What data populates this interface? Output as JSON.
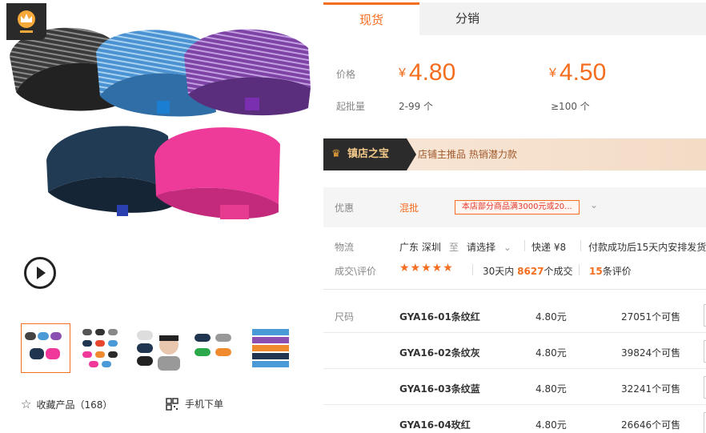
{
  "gallery": {
    "thumbnails_count": 5,
    "collect_label": "收藏产品（168）",
    "mobile_order_label": "手机下单"
  },
  "tabs": [
    {
      "label": "现货",
      "active": true
    },
    {
      "label": "分销",
      "active": false
    }
  ],
  "pricing": {
    "price_label": "价格",
    "moq_label": "起批量",
    "currency": "¥",
    "tiers": [
      {
        "price": "4.80",
        "range": "2-99 个"
      },
      {
        "price": "4.50",
        "range": "≥100 个"
      }
    ]
  },
  "treasure": {
    "tag": "镇店之宝",
    "text": "店铺主推品   热销潜力款"
  },
  "promo": {
    "label": "优惠",
    "type": "混批",
    "coupon": "本店部分商品满3000元或20..."
  },
  "logistics": {
    "label": "物流",
    "origin": "广东 深圳",
    "to": "至",
    "destination": "请选择",
    "shipping": "快递 ¥8",
    "delivery": "付款成功后15天内安排发货"
  },
  "reviews": {
    "label": "成交\\评价",
    "stars": "★★★★★",
    "sales_prefix": "30天内",
    "sales_count": "8627",
    "sales_suffix": "个成交",
    "review_count": "15",
    "review_suffix": "条评价"
  },
  "sku": {
    "label": "尺码",
    "rows": [
      {
        "name": "GYA16-01条纹红",
        "price": "4.80元",
        "stock": "27051个可售"
      },
      {
        "name": "GYA16-02条纹灰",
        "price": "4.80元",
        "stock": "39824个可售"
      },
      {
        "name": "GYA16-03条纹蓝",
        "price": "4.80元",
        "stock": "32241个可售"
      },
      {
        "name": "GYA16-04玫红",
        "price": "4.80元",
        "stock": "26646个可售"
      }
    ]
  },
  "colors": {
    "accent": "#f56d1f",
    "band_black": "#2b2b2b",
    "band_blue": "#4b9ad8",
    "band_purple": "#8a4fb0",
    "band_navy": "#1f3550",
    "band_pink": "#f0389b"
  }
}
